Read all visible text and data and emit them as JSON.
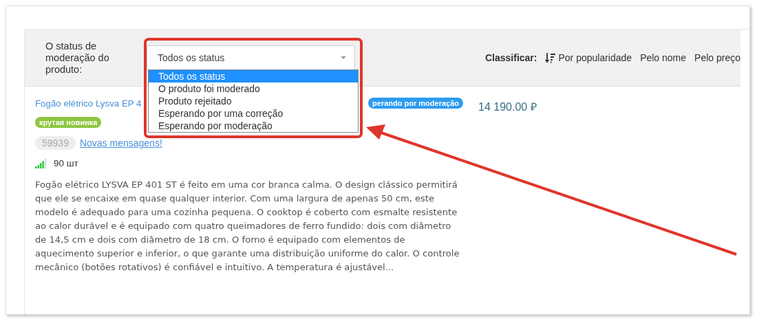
{
  "filter": {
    "label": "O status de moderação do produto:",
    "value": "Todos os status",
    "options": [
      {
        "label": "Todos os status",
        "selected": true
      },
      {
        "label": "O produto foi moderado",
        "selected": false
      },
      {
        "label": "Produto rejeitado",
        "selected": false
      },
      {
        "label": "Esperando por uma correção",
        "selected": false
      },
      {
        "label": "Esperando por moderação",
        "selected": false
      }
    ]
  },
  "sort": {
    "label": "Classificar:",
    "options": [
      {
        "label": "Por popularidade",
        "selected": true
      },
      {
        "label": "Pelo nome",
        "selected": false
      },
      {
        "label": "Pelo preço",
        "selected": false
      }
    ]
  },
  "product": {
    "title": "Fogão elétrico Lysva EP 4",
    "status": "perando por moderação",
    "price": "14 190.00 ₽",
    "tag": "крутая новинка",
    "id": "59939",
    "messages": "Novas mensagens!",
    "stock": "90 шт",
    "description": "Fogão elétrico LYSVA EP 401 ST é feito em uma cor branca calma. O design clássico permitirá que ele se encaixe em quase qualquer interior. Com uma largura de apenas 50 cm, este modelo é adequado para uma cozinha pequena. O cooktop é coberto com esmalte resistente ao calor durável e é equipado com quatro queimadores de ferro fundido: dois com diâmetro de 14,5 cm e dois com diâmetro de 18 cm. O forno é equipado com elementos de aquecimento superior e inferior, o que garante uma distribuição uniforme do calor. O controle mecânico (botões rotativos) é confiável e intuitivo. A temperatura é ajustável..."
  }
}
